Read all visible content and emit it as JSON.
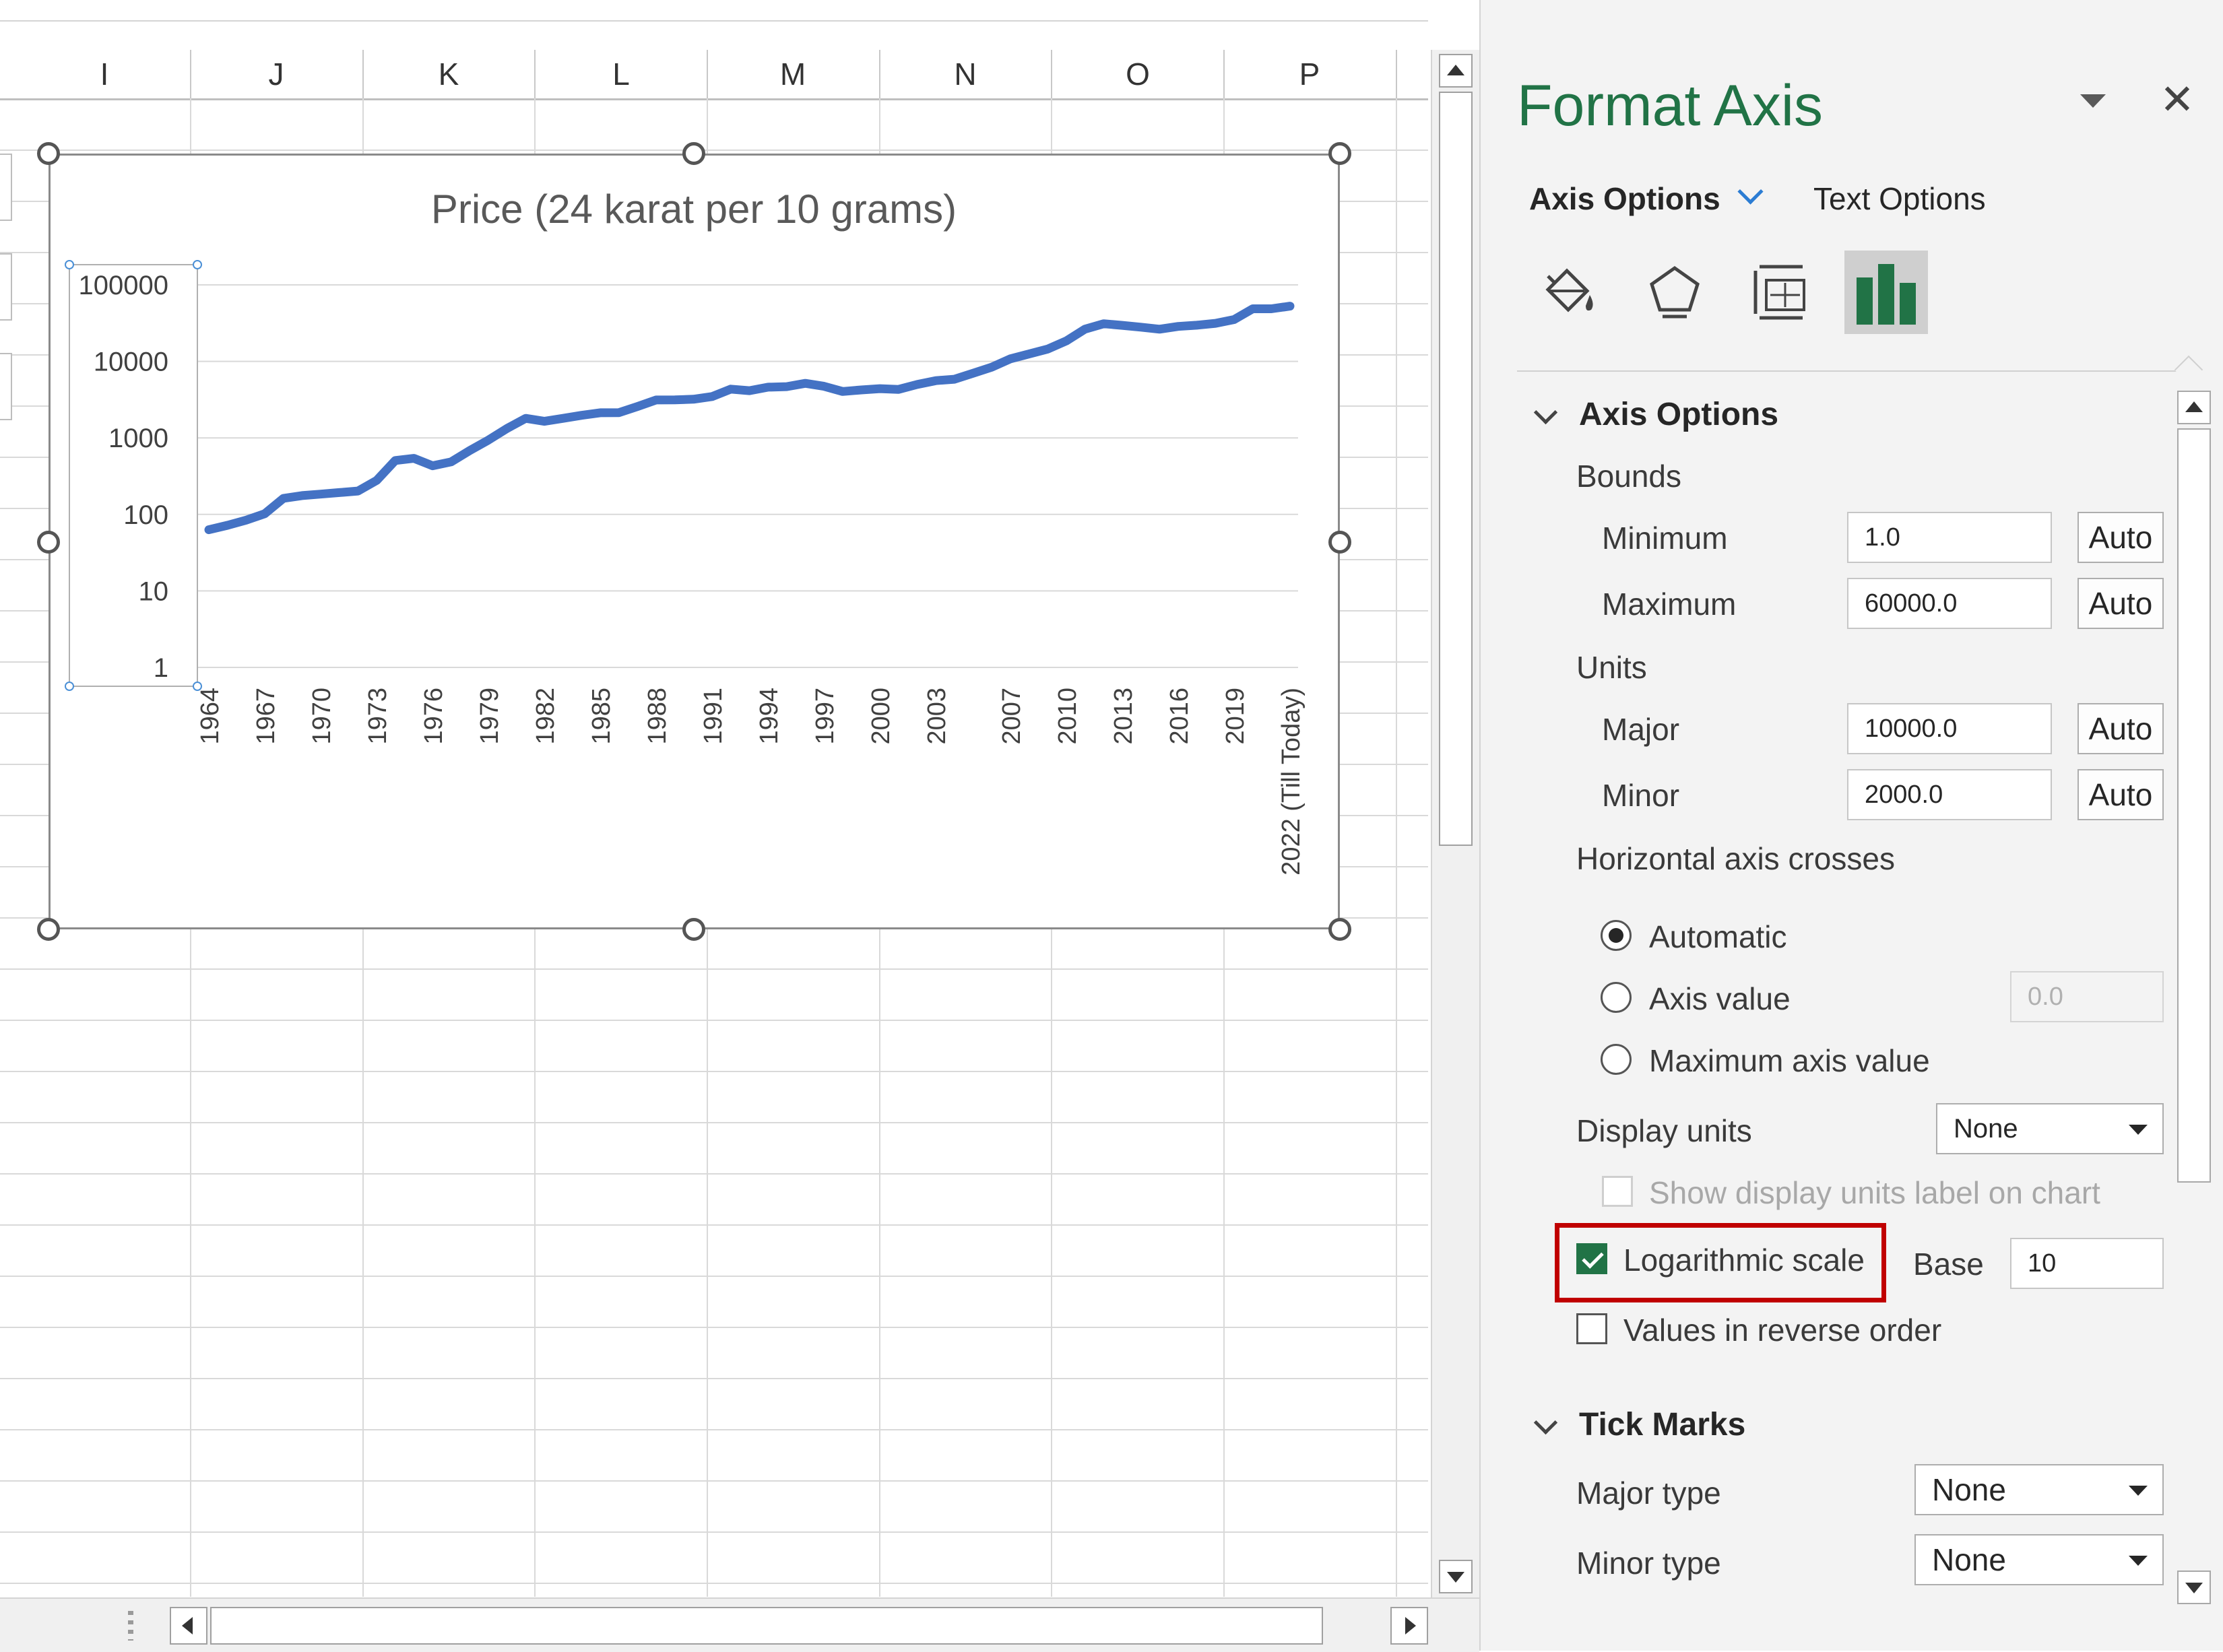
{
  "sheet": {
    "columns": [
      "I",
      "J",
      "K",
      "L",
      "M",
      "N",
      "O",
      "P"
    ]
  },
  "chart": {
    "title": "Price (24 karat per 10 grams)"
  },
  "chart_data": {
    "type": "line",
    "title": "Price (24 karat per 10 grams)",
    "y_scale": "log",
    "y_ticks": [
      "1",
      "10",
      "100",
      "1000",
      "10000",
      "100000"
    ],
    "x_tick_labels": [
      "1964",
      "1967",
      "1970",
      "1973",
      "1976",
      "1979",
      "1982",
      "1985",
      "1988",
      "1991",
      "1994",
      "1997",
      "2000",
      "2003",
      "2007",
      "2010",
      "2013",
      "2016",
      "2019",
      "2022 (Till Today)"
    ],
    "series": [
      {
        "color": "#4472c4",
        "x": [
          1964,
          1965,
          1966,
          1967,
          1968,
          1969,
          1970,
          1971,
          1972,
          1973,
          1974,
          1975,
          1976,
          1977,
          1978,
          1979,
          1980,
          1981,
          1982,
          1983,
          1984,
          1985,
          1986,
          1987,
          1988,
          1989,
          1990,
          1991,
          1992,
          1993,
          1994,
          1995,
          1996,
          1997,
          1998,
          1999,
          2000,
          2001,
          2002,
          2003,
          2004,
          2005,
          2006,
          2007,
          2008,
          2009,
          2010,
          2011,
          2012,
          2013,
          2014,
          2015,
          2016,
          2017,
          2018,
          2019,
          2020,
          2021,
          2022
        ],
        "y": [
          63,
          72,
          84,
          102,
          162,
          176,
          184,
          193,
          202,
          278,
          506,
          540,
          432,
          486,
          685,
          937,
          1330,
          1800,
          1645,
          1800,
          1970,
          2130,
          2140,
          2570,
          3130,
          3140,
          3200,
          3470,
          4334,
          4140,
          4598,
          4680,
          5160,
          4725,
          4045,
          4234,
          4400,
          4300,
          4990,
          5600,
          5850,
          7000,
          8400,
          10800,
          12500,
          14500,
          18500,
          26400,
          31050,
          29600,
          28006,
          26343,
          28623,
          29667,
          31438,
          35220,
          48651,
          48720,
          52670
        ]
      }
    ]
  },
  "pane": {
    "title": "Format Axis",
    "tabs": {
      "axis_options": "Axis Options",
      "text_options": "Text Options"
    },
    "axis_options_section": {
      "title": "Axis Options",
      "bounds_label": "Bounds",
      "minimum_label": "Minimum",
      "minimum_value": "1.0",
      "maximum_label": "Maximum",
      "maximum_value": "60000.0",
      "units_label": "Units",
      "major_label": "Major",
      "major_value": "10000.0",
      "minor_label": "Minor",
      "minor_value": "2000.0",
      "auto_label": "Auto",
      "crosses_label": "Horizontal axis crosses",
      "radio_automatic": "Automatic",
      "radio_axis_value": "Axis value",
      "axis_value": "0.0",
      "radio_maximum": "Maximum axis value",
      "display_units_label": "Display units",
      "display_units_value": "None",
      "show_units_label": "Show display units label on chart",
      "log_scale_label": "Logarithmic scale",
      "log_scale_checked": true,
      "base_label": "Base",
      "base_value": "10",
      "reverse_label": "Values in reverse order"
    },
    "tick_marks_section": {
      "title": "Tick Marks",
      "major_type_label": "Major type",
      "major_type_value": "None",
      "minor_type_label": "Minor type",
      "minor_type_value": "None"
    }
  }
}
